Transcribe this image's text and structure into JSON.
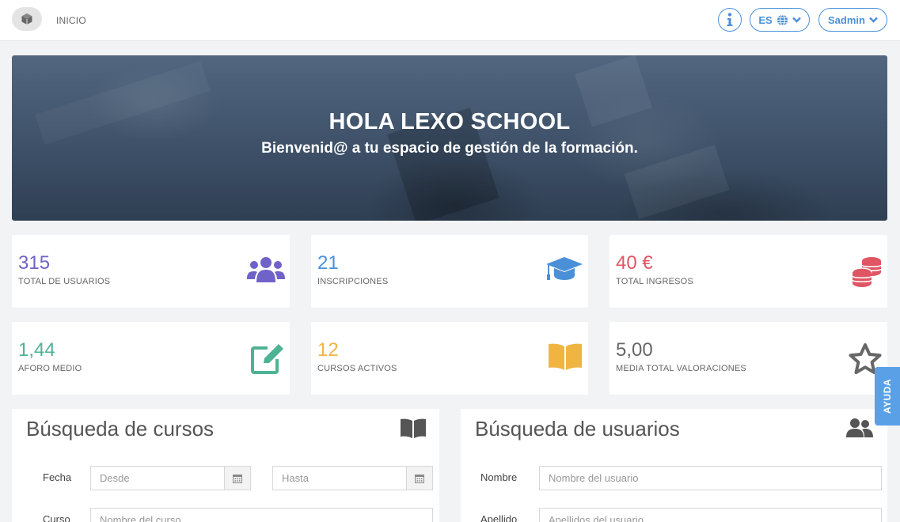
{
  "header": {
    "nav_inicio": "INICIO",
    "lang": "ES",
    "user": "Sadmin"
  },
  "banner": {
    "title": "HOLA LEXO SCHOOL",
    "subtitle": "Bienvenid@ a tu espacio de gestión de la formación."
  },
  "stats": [
    {
      "value": "315",
      "label": "TOTAL DE USUARIOS",
      "color": "#6f63c9",
      "icon": "users-icon"
    },
    {
      "value": "21",
      "label": "INSCRIPCIONES",
      "color": "#4a90d9",
      "icon": "graduation-cap-icon"
    },
    {
      "value": "40 €",
      "label": "TOTAL INGRESOS",
      "color": "#e05563",
      "icon": "coins-icon"
    },
    {
      "value": "1,44",
      "label": "AFORO MEDIO",
      "color": "#4db394",
      "icon": "edit-icon"
    },
    {
      "value": "12",
      "label": "CURSOS ACTIVOS",
      "color": "#f0b541",
      "icon": "book-open-icon"
    },
    {
      "value": "5,00",
      "label": "MEDIA TOTAL VALORACIONES",
      "color": "#666666",
      "icon": "star-icon"
    }
  ],
  "course_search": {
    "title": "Búsqueda de cursos",
    "fecha_label": "Fecha",
    "desde_placeholder": "Desde",
    "hasta_placeholder": "Hasta",
    "curso_label": "Curso",
    "curso_placeholder": "Nombre del curso"
  },
  "user_search": {
    "title": "Búsqueda de usuarios",
    "nombre_label": "Nombre",
    "nombre_placeholder": "Nombre del usuario",
    "apellido_label": "Apellido",
    "apellido_placeholder": "Apellidos del usuario"
  },
  "help_tab": "AYUDA",
  "colors": {
    "accent": "#4a90d9",
    "purple": "#6f63c9",
    "red": "#e05563",
    "green": "#4db394",
    "yellow": "#f0b541",
    "gray": "#666666"
  }
}
